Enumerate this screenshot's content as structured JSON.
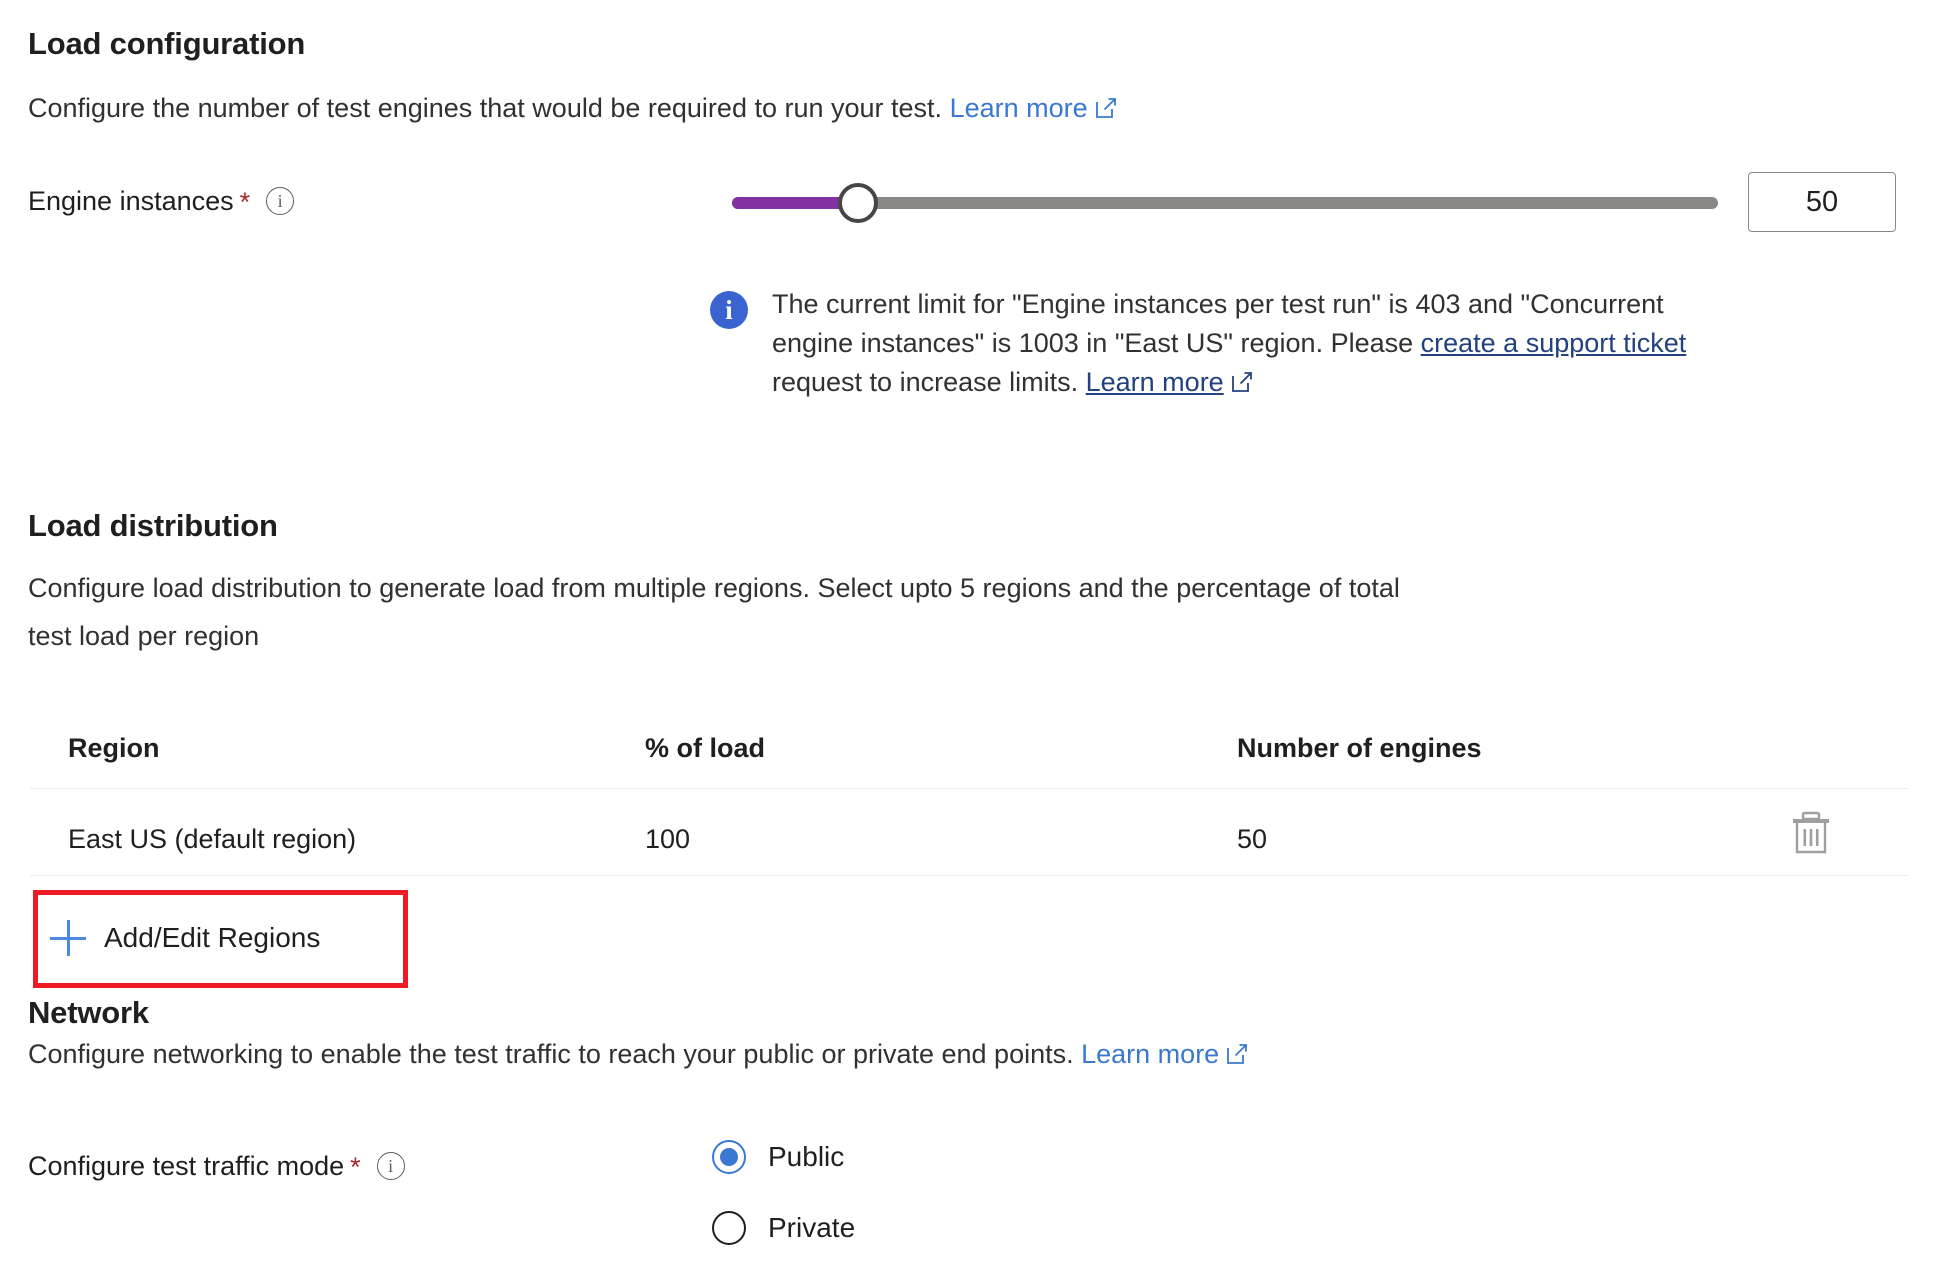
{
  "load_configuration": {
    "title": "Load configuration",
    "description_prefix": "Configure the number of test engines that would be required to run your test.",
    "learn_more": "Learn more",
    "engine_instances": {
      "label": "Engine instances",
      "required_marker": "*",
      "info_icon": "info-circle-outline-icon",
      "value": "50",
      "slider_min": 1,
      "slider_max": 403,
      "slider_value": 50,
      "fill_color": "#8232a0",
      "track_color": "#8a8886"
    },
    "info_message": {
      "icon": "info-filled-icon",
      "line1": "The current limit for \"Engine instances per test run\" is 403 and \"Concurrent",
      "line2_a": "engine instances\" is 1003 in \"East US\" region. Please ",
      "line2_link": "create a support ticket",
      "line3_a": "request to increase limits. ",
      "line3_link": "Learn more"
    }
  },
  "load_distribution": {
    "title": "Load distribution",
    "description_line1": "Configure load distribution to generate load from multiple regions. Select upto 5 regions and the percentage of total",
    "description_line2": "test load per region",
    "table": {
      "columns": [
        "Region",
        "% of load",
        "Number of engines"
      ],
      "rows": [
        {
          "region": "East US (default region)",
          "percent_of_load": "100",
          "number_of_engines": "50",
          "delete_icon": "trash-icon"
        }
      ]
    },
    "add_edit_regions": {
      "label": "Add/Edit Regions",
      "icon": "plus-icon",
      "highlight_color": "#ee1b24"
    }
  },
  "network": {
    "title": "Network",
    "description_prefix": "Configure networking to enable the test traffic to reach your public or private end points.",
    "learn_more": "Learn more",
    "traffic_mode": {
      "label": "Configure test traffic mode",
      "required_marker": "*",
      "info_icon": "info-circle-outline-icon",
      "selected": "Public",
      "options": [
        "Public",
        "Private"
      ]
    }
  },
  "colors": {
    "link": "#3a79d2",
    "link_visited_underline": "#22427f",
    "required": "#a4262c",
    "accent_slider": "#8232a0",
    "info_badge": "#3a62d0",
    "highlight": "#ee1b24"
  }
}
